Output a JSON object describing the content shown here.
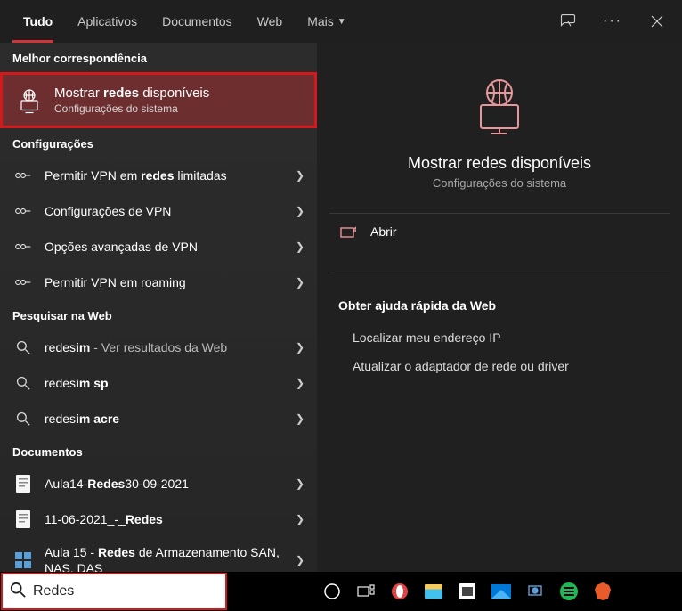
{
  "tabs": {
    "all": "Tudo",
    "apps": "Aplicativos",
    "docs": "Documentos",
    "web": "Web",
    "more": "Mais"
  },
  "sections": {
    "best_match": "Melhor correspondência",
    "settings": "Configurações",
    "search_web": "Pesquisar na Web",
    "documents": "Documentos"
  },
  "best": {
    "title_pre": "Mostrar ",
    "title_bold": "redes",
    "title_post": " disponíveis",
    "sub": "Configurações do sistema"
  },
  "settings_items": [
    {
      "pre": "Permitir VPN em ",
      "bold": "redes",
      "post": " limitadas"
    },
    {
      "pre": "Configurações de VPN",
      "bold": "",
      "post": ""
    },
    {
      "pre": "Opções avançadas de VPN",
      "bold": "",
      "post": ""
    },
    {
      "pre": "Permitir VPN em roaming",
      "bold": "",
      "post": ""
    }
  ],
  "web_items": [
    {
      "pre": "redes",
      "bold": "im",
      "post": "",
      "hint": " - Ver resultados da Web"
    },
    {
      "pre": "redes",
      "bold": "im sp",
      "post": "",
      "hint": ""
    },
    {
      "pre": "redes",
      "bold": "im acre",
      "post": "",
      "hint": ""
    }
  ],
  "doc_items": [
    {
      "pre": "Aula14-",
      "bold": "Redes",
      "post": "30-09-2021"
    },
    {
      "pre": "11-06-2021_-_",
      "bold": "Redes",
      "post": ""
    },
    {
      "pre": "Aula 15 - ",
      "bold": "Redes",
      "post": " de Armazenamento SAN, NAS, DAS"
    }
  ],
  "preview": {
    "title": "Mostrar redes disponíveis",
    "sub": "Configurações do sistema",
    "open": "Abrir",
    "help_header": "Obter ajuda rápida da Web",
    "help1": "Localizar meu endereço IP",
    "help2": "Atualizar o adaptador de rede ou driver"
  },
  "search": {
    "value": "Redes"
  }
}
